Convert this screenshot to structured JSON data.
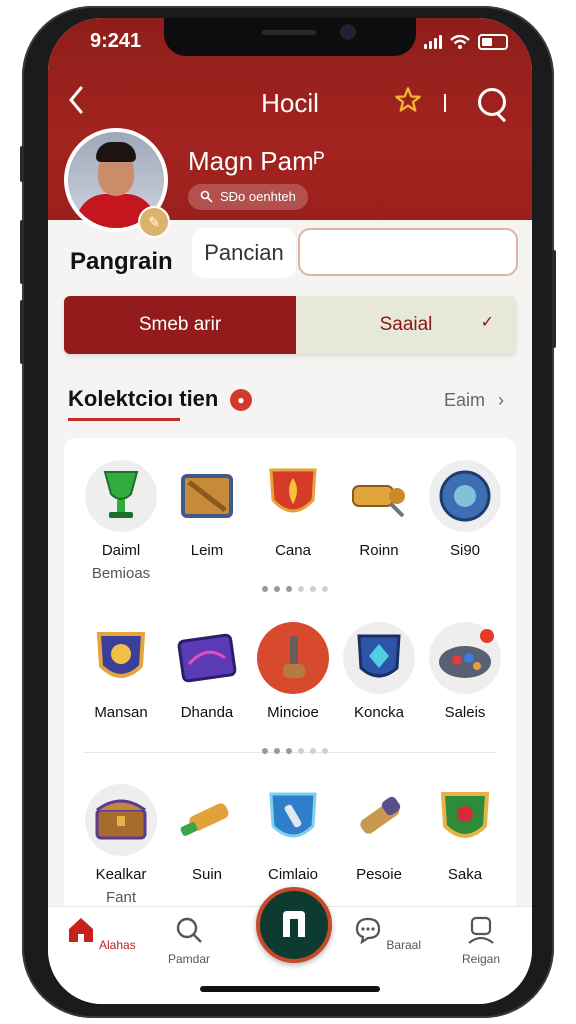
{
  "status_bar": {
    "time": "9:241"
  },
  "header": {
    "back_icon": "chevron-left-icon",
    "title": "Hocil",
    "star_icon": "star-icon",
    "search_icon": "search-icon"
  },
  "profile": {
    "name": "Magn Pamᴾ",
    "badge_text": "SÐo oenhteh",
    "username": "Pangrain",
    "field_label": "Pancian",
    "field_value": ""
  },
  "tabs": [
    {
      "label": "Smeb arir",
      "active": true
    },
    {
      "label": "Saaial",
      "active": false
    }
  ],
  "section": {
    "title": "Kolektcioı tien",
    "see_all": "Eaim"
  },
  "rows": [
    [
      {
        "label": "Daiml",
        "sub": "Bemioas",
        "icon": "green-chalice-icon"
      },
      {
        "label": "Leim",
        "sub": "",
        "icon": "wooden-crate-icon"
      },
      {
        "label": "Cana",
        "sub": "",
        "icon": "flame-shield-icon"
      },
      {
        "label": "Roinn",
        "sub": "",
        "icon": "golden-cannon-icon"
      },
      {
        "label": "Si90",
        "sub": "",
        "icon": "blue-orb-icon"
      }
    ],
    [
      {
        "label": "Mansan",
        "sub": "",
        "icon": "gold-crest-icon"
      },
      {
        "label": "Dhanda",
        "sub": "",
        "icon": "purple-card-icon"
      },
      {
        "label": "Mincioe",
        "sub": "",
        "icon": "hammer-icon"
      },
      {
        "label": "Koncka",
        "sub": "",
        "icon": "crystal-emblem-icon"
      },
      {
        "label": "Saleis",
        "sub": "",
        "icon": "gem-plate-icon"
      }
    ],
    [
      {
        "label": "Kealkar",
        "sub": "Fant",
        "icon": "treasure-chest-icon"
      },
      {
        "label": "Suin",
        "sub": "",
        "icon": "green-bolt-icon"
      },
      {
        "label": "Cimlaio",
        "sub": "",
        "icon": "blue-shield-icon"
      },
      {
        "label": "Pesoie",
        "sub": "",
        "icon": "scroll-icon"
      },
      {
        "label": "Saka",
        "sub": "",
        "icon": "ruby-shield-icon"
      }
    ]
  ],
  "bottom_nav": [
    {
      "label": "Alahas",
      "icon": "home-icon",
      "active": true
    },
    {
      "label": "Pamdar",
      "icon": "search-icon",
      "active": false
    },
    {
      "label": "",
      "icon": "center-action-icon",
      "active": false
    },
    {
      "label": "Baraal",
      "icon": "chat-icon",
      "active": false
    },
    {
      "label": "Reigan",
      "icon": "profile-icon",
      "active": false
    }
  ],
  "colors": {
    "brand_red": "#9b201c",
    "accent_gold": "#f2b530",
    "fab_green": "#0e3b2f"
  }
}
